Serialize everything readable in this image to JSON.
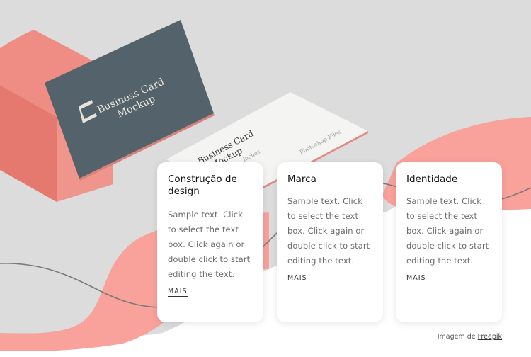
{
  "colors": {
    "background_gray": "#dcdcdc",
    "coral_wave": "#f9a19b",
    "coral_box": "#ee8a80",
    "card_dark": "#54636b",
    "line_gray": "#7a7a7a",
    "card_bg": "#ffffff",
    "title_color": "#111111",
    "text_color": "#6b6b6b"
  },
  "hero_image": {
    "front_card_title_line1": "Business Card",
    "front_card_title_line2": "Mockup",
    "back_card_title_line1": "Business Card",
    "back_card_title_line2": "Mockup",
    "back_card_small_text": "inches",
    "back_card_side_text": "Photoshop Files"
  },
  "cards": [
    {
      "title": "Construção de design",
      "text": "Sample text. Click to select the text box. Click again or double click to start editing the text.",
      "link_label": "MAIS"
    },
    {
      "title": "Marca",
      "text": "Sample text. Click to select the text box. Click again or double click to start editing the text.",
      "link_label": "MAIS"
    },
    {
      "title": "Identidade",
      "text": "Sample text. Click to select the text box. Click again or double click to start editing the text.",
      "link_label": "MAIS"
    }
  ],
  "credit": {
    "prefix": "Imagem de",
    "link_label": "Freepik"
  }
}
